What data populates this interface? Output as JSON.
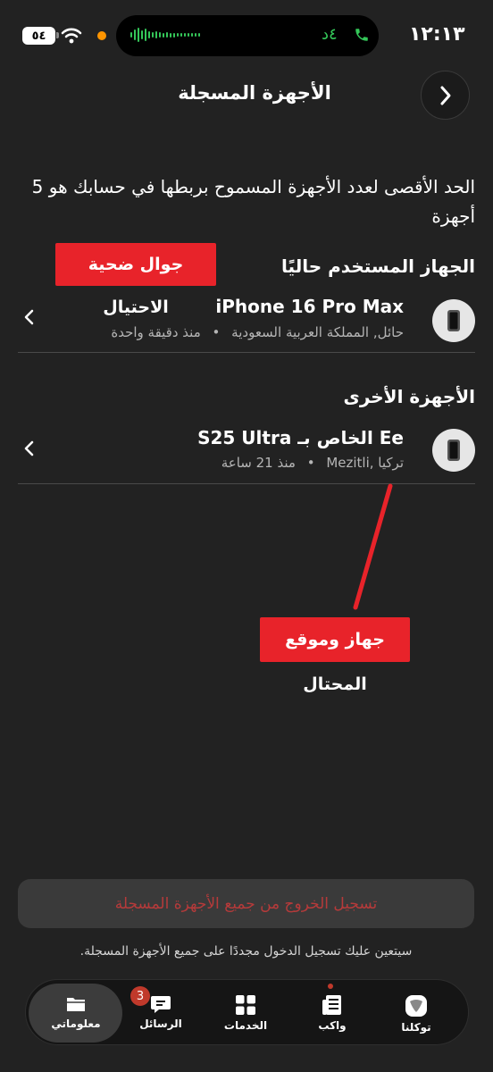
{
  "status_bar": {
    "time": "١٢:١٣",
    "call_duration": "٤د",
    "battery": "٥٤"
  },
  "header": {
    "title": "الأجهزة المسجلة"
  },
  "description": "الحد الأقصى لعدد الأجهزة المسموح بربطها في حسابك هو 5 أجهزة",
  "current_device": {
    "section_title": "الجهاز المستخدم حاليًا",
    "name": "iPhone 16 Pro Max",
    "location": "حائل, المملكة العربية السعودية",
    "time": "منذ دقيقة واحدة"
  },
  "other_devices": {
    "section_title": "الأجهزة الأخرى",
    "items": [
      {
        "name": "Ee الخاص بـ S25 Ultra",
        "location": "تركيا ,Mezitli",
        "time": "منذ 21 ساعة"
      }
    ]
  },
  "annotations": {
    "victim_phone": "جوال ضحية الاحتيال",
    "scammer_device": "جهاز وموقع المحتال",
    "colors": {
      "red": "#e8232a"
    }
  },
  "logout": {
    "button_label": "تسجيل الخروج من جميع الأجهزة المسجلة",
    "note": "سيتعين عليك تسجيل الدخول مجددًا على جميع الأجهزة المسجلة."
  },
  "tabbar": {
    "badge_count": "3",
    "tabs": [
      {
        "label": "معلوماتي",
        "icon": "folder-icon",
        "active": true
      },
      {
        "label": "الرسائل",
        "icon": "chat-icon",
        "active": false
      },
      {
        "label": "الخدمات",
        "icon": "grid-icon",
        "active": false
      },
      {
        "label": "واكب",
        "icon": "news-icon",
        "active": false
      },
      {
        "label": "توكلنا",
        "icon": "tawakkalna-icon",
        "active": false
      }
    ]
  }
}
